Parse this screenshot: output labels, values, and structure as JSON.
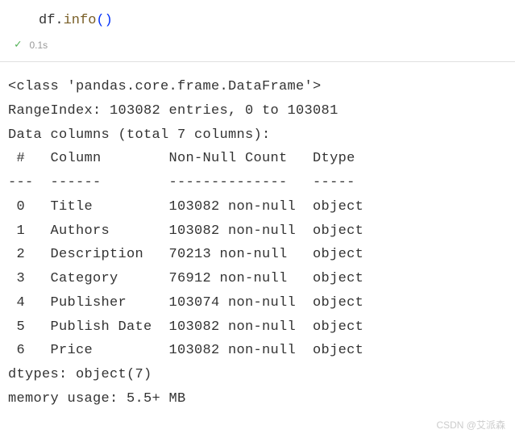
{
  "code": {
    "var": "df",
    "method": "info",
    "parens": "()"
  },
  "status": {
    "check": "✓",
    "time": "0.1s"
  },
  "output": {
    "class_line": "<class 'pandas.core.frame.DataFrame'>",
    "range_index": "RangeIndex: 103082 entries, 0 to 103081",
    "data_columns": "Data columns (total 7 columns):",
    "header": " #   Column        Non-Null Count   Dtype ",
    "divider": "---  ------        --------------   ----- ",
    "rows": [
      " 0   Title         103082 non-null  object",
      " 1   Authors       103082 non-null  object",
      " 2   Description   70213 non-null   object",
      " 3   Category      76912 non-null   object",
      " 4   Publisher     103074 non-null  object",
      " 5   Publish Date  103082 non-null  object",
      " 6   Price         103082 non-null  object"
    ],
    "dtypes": "dtypes: object(7)",
    "memory": "memory usage: 5.5+ MB"
  },
  "watermark": "CSDN @艾派森"
}
